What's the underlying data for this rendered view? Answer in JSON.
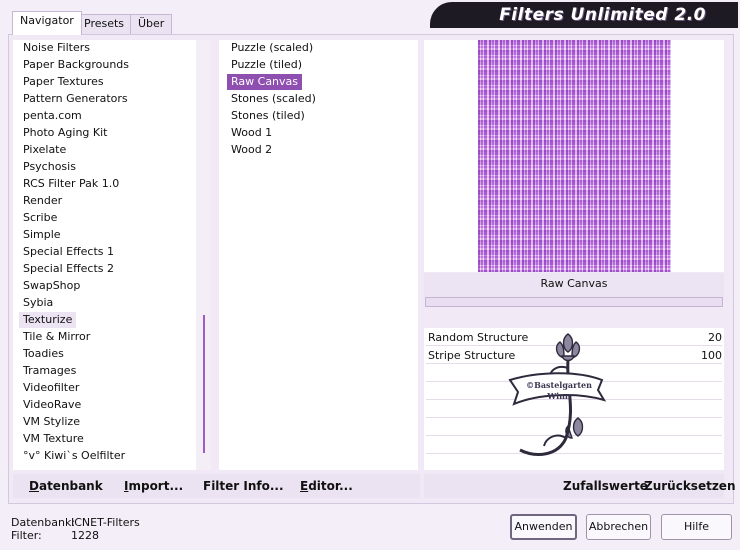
{
  "app": {
    "title": "Filters Unlimited 2.0"
  },
  "tabs": [
    "Navigator",
    "Presets",
    "Über"
  ],
  "categories": [
    "Noise Filters",
    "Paper Backgrounds",
    "Paper Textures",
    "Pattern Generators",
    "penta.com",
    "Photo Aging Kit",
    "Pixelate",
    "Psychosis",
    "RCS Filter Pak 1.0",
    "Render",
    "Scribe",
    "Simple",
    "Special Effects 1",
    "Special Effects 2",
    "SwapShop",
    "Sybia",
    "Texturize",
    "Tile & Mirror",
    "Toadies",
    "Tramages",
    "Videofilter",
    "VideoRave",
    "VM Stylize",
    "VM Texture",
    "°v° Kiwi`s Oelfilter"
  ],
  "selected_category": "Texturize",
  "filters": [
    "Puzzle (scaled)",
    "Puzzle (tiled)",
    "Raw Canvas",
    "Stones (scaled)",
    "Stones (tiled)",
    "Wood 1",
    "Wood 2"
  ],
  "selected_filter": "Raw Canvas",
  "preview": {
    "label": "Raw Canvas"
  },
  "parameters": [
    {
      "label": "Random Structure",
      "value": "20"
    },
    {
      "label": "Stripe Structure",
      "value": "100"
    }
  ],
  "watermark": {
    "line1": "©Bastelgarten",
    "line2": "Winn"
  },
  "toolbar_left": [
    {
      "key": "D",
      "rest": "atenbank"
    },
    {
      "key": "I",
      "rest": "mport..."
    },
    {
      "key": "Filter I",
      "rest": "nfo..."
    },
    {
      "key": "E",
      "rest": "ditor..."
    }
  ],
  "toolbar_right": [
    {
      "label": "Zufallswerte"
    },
    {
      "label": "Zurücksetzen"
    }
  ],
  "info": {
    "db_label": "Datenbank:",
    "db_value": "ICNET-Filters",
    "filter_label": "Filter:",
    "filter_value": "1228"
  },
  "buttons": {
    "apply": "Anwenden",
    "cancel": "Abbrechen",
    "help": "Hilfe"
  },
  "colors": {
    "selection": "#8e4fb0",
    "accent": "#a25ac4",
    "banner": "#1e1a24"
  }
}
